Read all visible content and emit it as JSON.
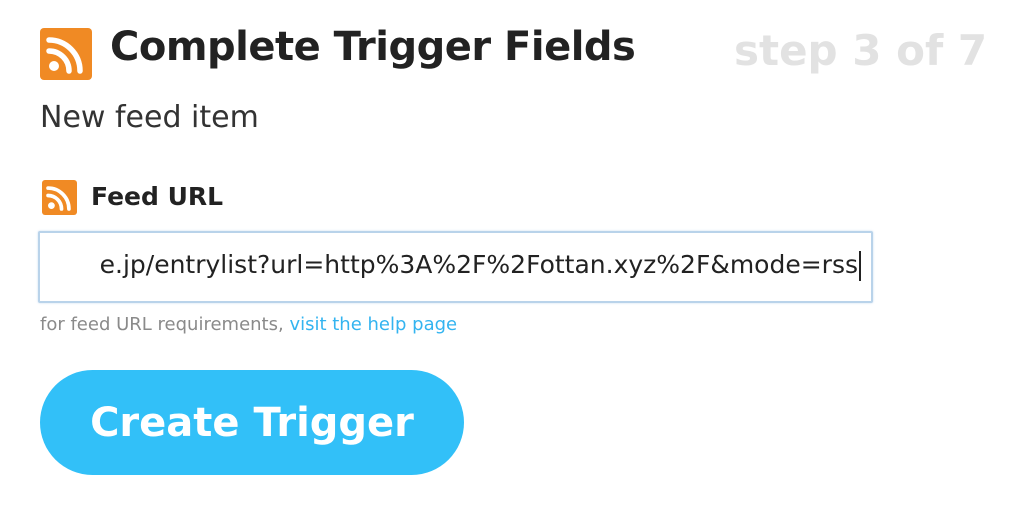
{
  "header": {
    "title": "Complete Trigger Fields",
    "step": "step 3 of 7",
    "icon": "rss-feed-icon",
    "icon_color": "#f08a24"
  },
  "subtitle": "New feed item",
  "field": {
    "label": "Feed URL",
    "icon": "rss-feed-icon",
    "value": "e.jp/entrylist?url=http%3A%2F%2Fottan.xyz%2F&mode=rss"
  },
  "help": {
    "text": "for feed URL requirements, ",
    "link": "visit the help page"
  },
  "button": {
    "label": "Create Trigger",
    "color": "#32c0f8"
  }
}
